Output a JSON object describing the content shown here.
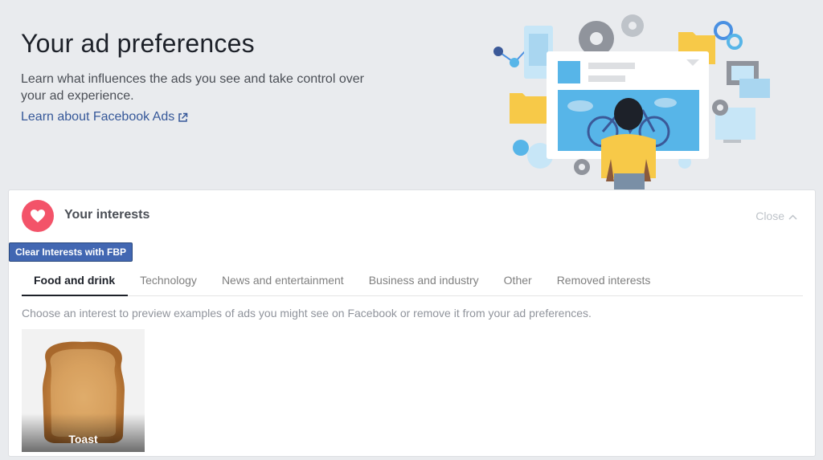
{
  "hero": {
    "title": "Your ad preferences",
    "description": "Learn what influences the ads you see and take control over your ad experience.",
    "link_label": "Learn about Facebook Ads"
  },
  "interests": {
    "title": "Your interests",
    "close_label": "Close",
    "fbp_button_label": "Clear Interests with FBP",
    "tabs": [
      {
        "label": "Food and drink",
        "active": true
      },
      {
        "label": "Technology",
        "active": false
      },
      {
        "label": "News and entertainment",
        "active": false
      },
      {
        "label": "Business and industry",
        "active": false
      },
      {
        "label": "Other",
        "active": false
      },
      {
        "label": "Removed interests",
        "active": false
      }
    ],
    "hint": "Choose an interest to preview examples of ads you might see on Facebook or remove it from your ad preferences.",
    "items": [
      {
        "label": "Toast"
      }
    ]
  },
  "colors": {
    "background": "#e9ebee",
    "link": "#365899",
    "button": "#4267b2",
    "heart": "#f35369"
  },
  "icons": {
    "link": "external-link-icon",
    "header": "heart-icon",
    "close": "chevron-up-icon"
  }
}
